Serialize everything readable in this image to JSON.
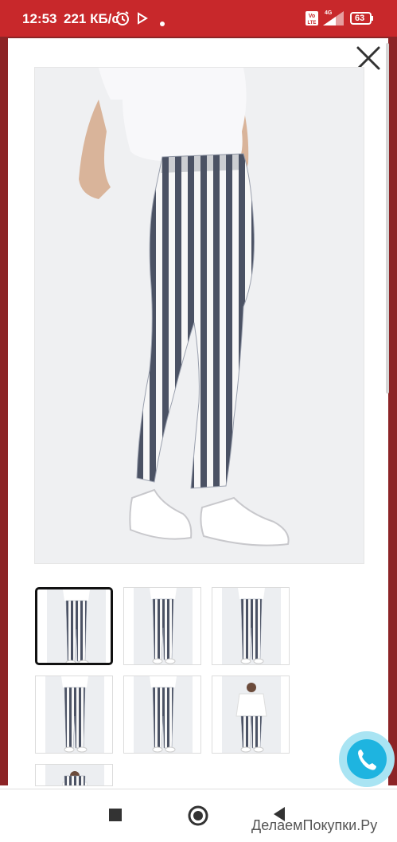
{
  "status_bar": {
    "time": "12:53",
    "speed": "221 КБ/с",
    "volte": "Vo LTE",
    "network": "4G",
    "battery": "63"
  },
  "gallery": {
    "main_image": "striped-pants-front",
    "thumbnails": [
      {
        "id": "thumb-1",
        "image": "striped-pants-side",
        "active": true
      },
      {
        "id": "thumb-2",
        "image": "striped-pants-front",
        "active": false
      },
      {
        "id": "thumb-3",
        "image": "striped-pants-side-2",
        "active": false
      },
      {
        "id": "thumb-4",
        "image": "striped-pants-back",
        "active": false
      },
      {
        "id": "thumb-5",
        "image": "striped-pants-detail",
        "active": false
      },
      {
        "id": "thumb-6",
        "image": "model-full-white-tee",
        "active": false
      },
      {
        "id": "thumb-7",
        "image": "model-full-partial",
        "active": false
      }
    ]
  },
  "colors": {
    "status_bar": "#c8282b",
    "overlay": "#8c2426",
    "stripe_dark": "#4b5264",
    "call_button": "#1eb4e0"
  },
  "watermark": "ДелаемПокупки.Ру",
  "icons": [
    "close-icon",
    "phone-icon",
    "nav-square-icon",
    "nav-home-icon",
    "nav-back-icon",
    "alarm-icon",
    "play-icon"
  ]
}
